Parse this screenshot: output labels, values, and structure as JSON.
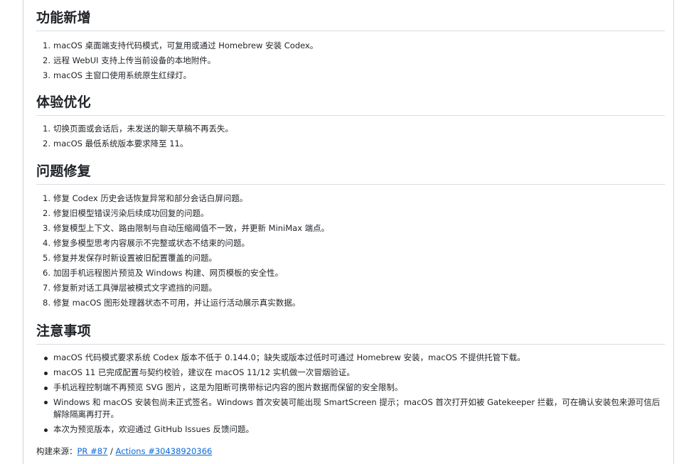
{
  "sections": [
    {
      "title": "功能新增",
      "items": [
        "macOS 桌面端支持代码模式，可复用或通过 Homebrew 安装 Codex。",
        "远程 WebUI 支持上传当前设备的本地附件。",
        "macOS 主窗口使用系统原生红绿灯。"
      ]
    },
    {
      "title": "体验优化",
      "items": [
        "切换页面或会话后，未发送的聊天草稿不再丢失。",
        "macOS 最低系统版本要求降至 11。"
      ]
    },
    {
      "title": "问题修复",
      "items": [
        "修复 Codex 历史会话恢复异常和部分会话白屏问题。",
        "修复旧模型错误污染后续成功回复的问题。",
        "修复模型上下文、路由限制与自动压缩阈值不一致，并更新 MiniMax 端点。",
        "修复多模型思考内容展示不完整或状态不结束的问题。",
        "修复并发保存时新设置被旧配置覆盖的问题。",
        "加固手机远程图片预览及 Windows 构建、网页模板的安全性。",
        "修复新对话工具弹层被模式文字遮挡的问题。",
        "修复 macOS 图形处理器状态不可用，并让运行活动展示真实数据。"
      ]
    },
    {
      "title": "注意事项",
      "items": [
        "macOS 代码模式要求系统 Codex 版本不低于 0.144.0；缺失或版本过低时可通过 Homebrew 安装，macOS 不提供托管下载。",
        "macOS 11 已完成配置与契约校验，建议在 macOS 11/12 实机做一次冒烟验证。",
        "手机远程控制端不再预览 SVG 图片，这是为阻断可携带标记内容的图片数据而保留的安全限制。",
        "Windows 和 macOS 安装包尚未正式签名。Windows 首次安装可能出现 SmartScreen 提示；macOS 首次打开如被 Gatekeeper 拦截，可在确认安装包来源可信后解除隔离再打开。",
        "本次为预览版本，欢迎通过 GitHub Issues 反馈问题。"
      ]
    }
  ],
  "numbers": [
    "1.",
    "2.",
    "3.",
    "4.",
    "5.",
    "6.",
    "7.",
    "8."
  ],
  "source": {
    "label": "构建来源：",
    "pr_link": "PR #87",
    "separator": " / ",
    "actions_link": "Actions #30438920366"
  },
  "colors": {
    "text": "#1f2328",
    "link": "#0969da",
    "border": "#d0d7de"
  }
}
